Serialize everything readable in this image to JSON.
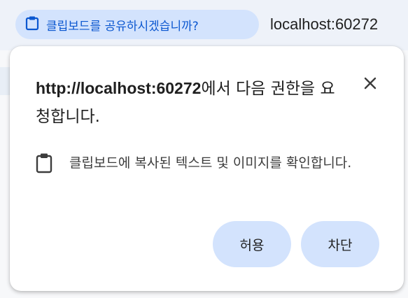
{
  "address_bar": {
    "permission_chip": {
      "icon": "clipboard-icon",
      "label": "클립보드를 공유하시겠습니까?"
    },
    "url": "localhost:60272"
  },
  "dialog": {
    "title_origin": "http://localhost:60272",
    "title_rest": "에서 다음 권한을 요청합니다.",
    "close_icon": "close-icon",
    "permission": {
      "icon": "clipboard-icon",
      "description": "클립보드에 복사된 텍스트 및 이미지를 확인합니다."
    },
    "buttons": {
      "allow": "허용",
      "block": "차단"
    }
  },
  "colors": {
    "chip_background": "#d3e3fd",
    "chip_text": "#0b57d0",
    "button_background": "#d3e3fd",
    "dialog_background": "#ffffff",
    "topbar_background": "#eef2f9"
  }
}
